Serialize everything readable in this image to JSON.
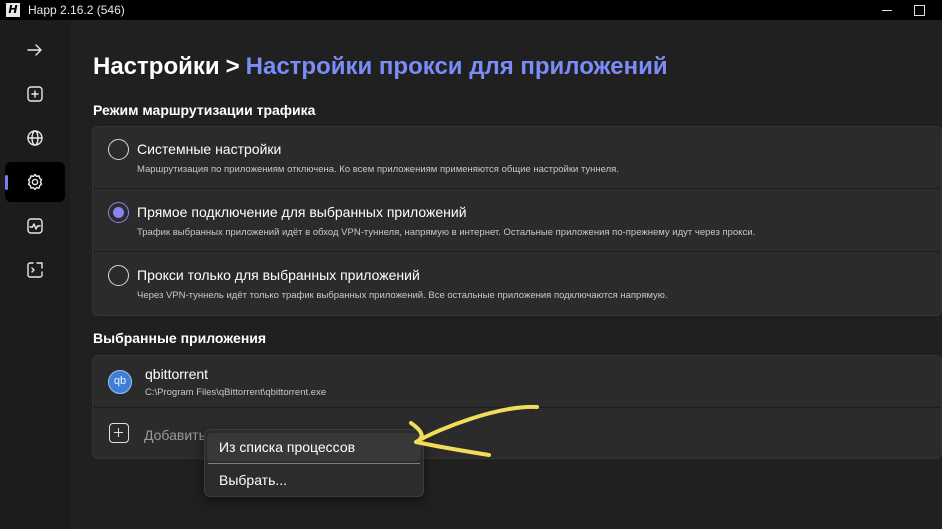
{
  "window": {
    "title": "Happ 2.16.2 (546)",
    "logo_glyph": "H"
  },
  "sidebar": {
    "items": [
      {
        "icon": "arrow-right-icon",
        "active": false
      },
      {
        "icon": "add-square-icon",
        "active": false
      },
      {
        "icon": "globe-icon",
        "active": false
      },
      {
        "icon": "gear-icon",
        "active": true
      },
      {
        "icon": "activity-monitor-icon",
        "active": false
      },
      {
        "icon": "log-console-icon",
        "active": false
      }
    ]
  },
  "breadcrumb": {
    "root": "Настройки",
    "separator": ">",
    "current": "Настройки прокси для приложений"
  },
  "routing": {
    "section_label": "Режим маршрутизации трафика",
    "options": [
      {
        "title": "Системные настройки",
        "description": "Маршрутизация по приложениям отключена. Ко всем приложениям применяются общие настройки туннеля.",
        "selected": false
      },
      {
        "title": "Прямое подключение для выбранных приложений",
        "description": "Трафик выбранных приложений идёт в обход VPN-туннеля, напрямую в интернет. Остальные приложения по-прежнему идут через прокси.",
        "selected": true
      },
      {
        "title": "Прокси только для выбранных приложений",
        "description": "Через VPN-туннель идёт только трафик выбранных приложений. Все остальные приложения подключаются напрямую.",
        "selected": false
      }
    ]
  },
  "selected_apps": {
    "section_label": "Выбранные приложения",
    "apps": [
      {
        "icon_text": "qb",
        "name": "qbittorrent",
        "path": "C:\\Program Files\\qBittorrent\\qbittorrent.exe"
      }
    ],
    "add_label": "Добавить"
  },
  "context_menu": {
    "items": [
      {
        "label": "Из списка процессов"
      },
      {
        "label": "Выбрать..."
      }
    ]
  },
  "colors": {
    "accent": "#7b8cf7",
    "radio_selected": "#8a84f0",
    "annotation_arrow": "#f2dd5a"
  }
}
